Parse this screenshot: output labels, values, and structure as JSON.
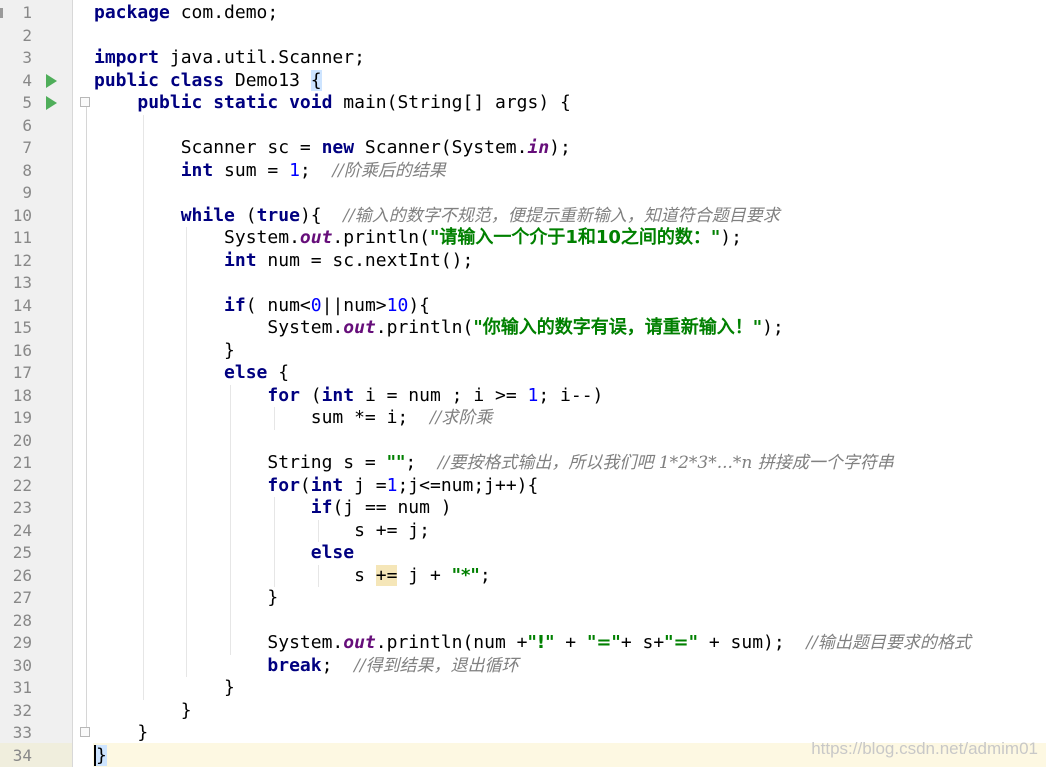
{
  "editor": {
    "language": "java",
    "current_line": 34,
    "watermark": "https://blog.csdn.net/admim01",
    "colors": {
      "keyword": "#000080",
      "number": "#0000ff",
      "string": "#008000",
      "field": "#660e7a",
      "comment": "#808080",
      "gutter_bg": "#f0f0f0",
      "current_line_bg": "#fdf8e2",
      "run_icon": "#4fae5a"
    },
    "gutter": {
      "line_numbers": [
        "1",
        "2",
        "3",
        "4",
        "5",
        "6",
        "7",
        "8",
        "9",
        "10",
        "11",
        "12",
        "13",
        "14",
        "15",
        "16",
        "17",
        "18",
        "19",
        "20",
        "21",
        "22",
        "23",
        "24",
        "25",
        "26",
        "27",
        "28",
        "29",
        "30",
        "31",
        "32",
        "33",
        "34"
      ],
      "run_icons": [
        4,
        5
      ]
    },
    "lines": [
      [
        [
          "kw",
          "package"
        ],
        [
          "t",
          " com.demo;"
        ]
      ],
      [],
      [
        [
          "kw",
          "import"
        ],
        [
          "t",
          " java.util.Scanner;"
        ]
      ],
      [
        [
          "kw",
          "public class"
        ],
        [
          "t",
          " Demo13 "
        ],
        [
          "brace",
          "{"
        ]
      ],
      [
        [
          "t",
          "    "
        ],
        [
          "kw",
          "public static void"
        ],
        [
          "t",
          " main(String[] args) {"
        ]
      ],
      [],
      [
        [
          "t",
          "        Scanner sc = "
        ],
        [
          "kw",
          "new"
        ],
        [
          "t",
          " Scanner(System."
        ],
        [
          "fld",
          "in"
        ],
        [
          "t",
          ");"
        ]
      ],
      [
        [
          "t",
          "        "
        ],
        [
          "kw",
          "int"
        ],
        [
          "t",
          " sum = "
        ],
        [
          "num",
          "1"
        ],
        [
          "t",
          ";  "
        ],
        [
          "cmt",
          "//阶乘后的结果"
        ]
      ],
      [],
      [
        [
          "t",
          "        "
        ],
        [
          "kw",
          "while"
        ],
        [
          "t",
          " ("
        ],
        [
          "kw",
          "true"
        ],
        [
          "t",
          "){  "
        ],
        [
          "cmt",
          "//输入的数字不规范，便提示重新输入，知道符合题目要求"
        ]
      ],
      [
        [
          "t",
          "            System."
        ],
        [
          "fld",
          "out"
        ],
        [
          "t",
          ".println("
        ],
        [
          "str",
          "\"请输入一个介于1和10之间的数：\""
        ],
        [
          "t",
          ");"
        ]
      ],
      [
        [
          "t",
          "            "
        ],
        [
          "kw",
          "int"
        ],
        [
          "t",
          " num = sc.nextInt();"
        ]
      ],
      [],
      [
        [
          "t",
          "            "
        ],
        [
          "kw",
          "if"
        ],
        [
          "t",
          "( num<"
        ],
        [
          "num",
          "0"
        ],
        [
          "t",
          "||num>"
        ],
        [
          "num",
          "10"
        ],
        [
          "t",
          "){"
        ]
      ],
      [
        [
          "t",
          "                System."
        ],
        [
          "fld",
          "out"
        ],
        [
          "t",
          ".println("
        ],
        [
          "str",
          "\"你输入的数字有误，请重新输入！\""
        ],
        [
          "t",
          ");"
        ]
      ],
      [
        [
          "t",
          "            }"
        ]
      ],
      [
        [
          "t",
          "            "
        ],
        [
          "kw",
          "else"
        ],
        [
          "t",
          " {"
        ]
      ],
      [
        [
          "t",
          "                "
        ],
        [
          "kw",
          "for"
        ],
        [
          "t",
          " ("
        ],
        [
          "kw",
          "int"
        ],
        [
          "t",
          " i = num ; i >= "
        ],
        [
          "num",
          "1"
        ],
        [
          "t",
          "; i--)"
        ]
      ],
      [
        [
          "t",
          "                    sum *= i;  "
        ],
        [
          "cmt",
          "//求阶乘"
        ]
      ],
      [],
      [
        [
          "t",
          "                String s = "
        ],
        [
          "str",
          "\"\""
        ],
        [
          "t",
          ";  "
        ],
        [
          "cmt",
          "//要按格式输出，所以我们吧 1*2*3*...*n 拼接成一个字符串"
        ]
      ],
      [
        [
          "t",
          "                "
        ],
        [
          "kw",
          "for"
        ],
        [
          "t",
          "("
        ],
        [
          "kw",
          "int"
        ],
        [
          "t",
          " j ="
        ],
        [
          "num",
          "1"
        ],
        [
          "t",
          ";j<=num;j++){"
        ]
      ],
      [
        [
          "t",
          "                    "
        ],
        [
          "kw",
          "if"
        ],
        [
          "t",
          "(j == num )"
        ]
      ],
      [
        [
          "t",
          "                        s += j;"
        ]
      ],
      [
        [
          "t",
          "                    "
        ],
        [
          "kw",
          "else"
        ]
      ],
      [
        [
          "t",
          "                        s "
        ],
        [
          "ophl",
          "+="
        ],
        [
          "t",
          " j + "
        ],
        [
          "str",
          "\"*\""
        ],
        [
          "t",
          ";"
        ]
      ],
      [
        [
          "t",
          "                }"
        ]
      ],
      [],
      [
        [
          "t",
          "                System."
        ],
        [
          "fld",
          "out"
        ],
        [
          "t",
          ".println(num +"
        ],
        [
          "str",
          "\"!\""
        ],
        [
          "t",
          " + "
        ],
        [
          "str",
          "\"=\""
        ],
        [
          "t",
          "+ s+"
        ],
        [
          "str",
          "\"=\""
        ],
        [
          "t",
          " + sum);  "
        ],
        [
          "cmt",
          "//输出题目要求的格式"
        ]
      ],
      [
        [
          "t",
          "                "
        ],
        [
          "kw",
          "break"
        ],
        [
          "t",
          ";  "
        ],
        [
          "cmt",
          "//得到结果，退出循环"
        ]
      ],
      [
        [
          "t",
          "            }"
        ]
      ],
      [
        [
          "t",
          "        }"
        ]
      ],
      [
        [
          "t",
          "    }"
        ]
      ],
      [
        [
          "caret",
          "}"
        ]
      ]
    ]
  }
}
